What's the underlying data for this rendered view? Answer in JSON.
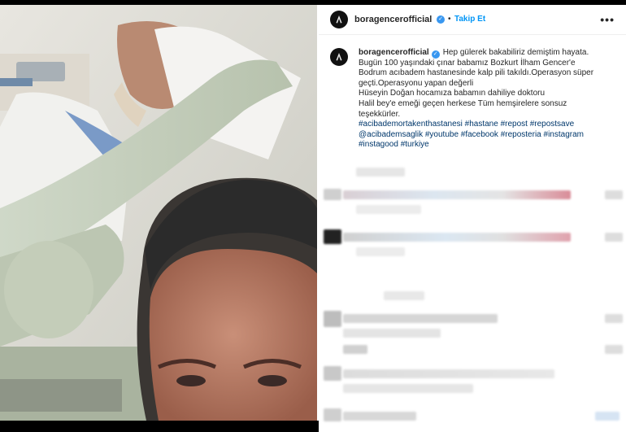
{
  "post": {
    "username": "boragencerofficial",
    "separator": "•",
    "follow_label": "Takip Et",
    "more_label": "•••",
    "caption_lines": [
      "Hep gülerek bakabiliriz demiştim hayata.",
      "Bugün 100 yaşındaki çınar babamız Bozkurt İlham Gencer'e",
      "Bodrum acıbadem hastanesinde kalp pili takıldı.Operasyon süper",
      "geçti.Operasyonu yapan değerli",
      "Hüseyin Doğan hocamıza babamın dahiliye doktoru",
      "Halil bey'e emeği geçen herkese Tüm hemşirelere sonsuz",
      "teşekkürler."
    ],
    "hashtag_lines": [
      "#acibademortakenthastanesi #hastane #repost #repostsave",
      "@acibademsaglik #youtube #facebook #reposteria #instagram",
      "#instagood #turkiye"
    ]
  },
  "icons": {
    "avatar": "ribbon-logo-icon",
    "verified": "verified-badge-icon",
    "more": "more-options-icon"
  },
  "colors": {
    "link": "#0095f6",
    "hashtag": "#00376b",
    "verified": "#3897f0",
    "text": "#262626"
  }
}
